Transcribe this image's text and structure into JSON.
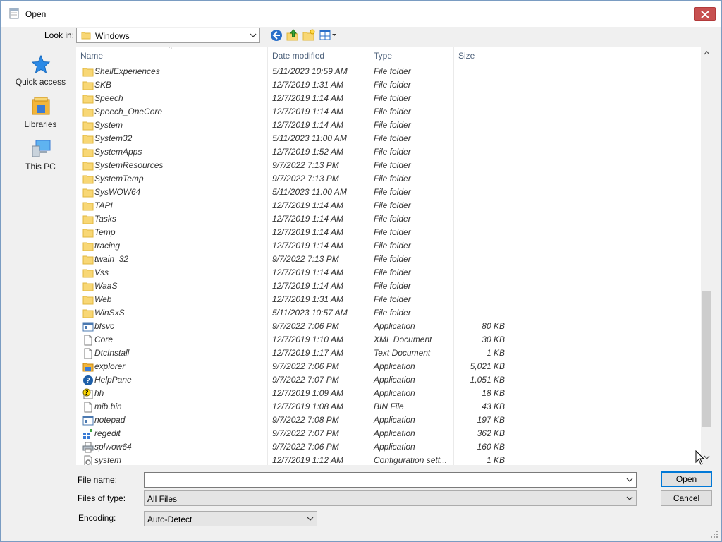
{
  "window": {
    "title": "Open"
  },
  "toolbar": {
    "look_in_label": "Look in:",
    "look_in_value": "Windows"
  },
  "places": [
    {
      "label": "Quick access",
      "icon": "star-icon"
    },
    {
      "label": "Libraries",
      "icon": "libraries-icon"
    },
    {
      "label": "This PC",
      "icon": "computer-icon"
    }
  ],
  "columns": {
    "name": "Name",
    "date": "Date modified",
    "type": "Type",
    "size": "Size"
  },
  "files": [
    {
      "name": "ShellExperiences",
      "date": "5/11/2023 10:59 AM",
      "type": "File folder",
      "size": "",
      "icon": "folder"
    },
    {
      "name": "SKB",
      "date": "12/7/2019 1:31 AM",
      "type": "File folder",
      "size": "",
      "icon": "folder"
    },
    {
      "name": "Speech",
      "date": "12/7/2019 1:14 AM",
      "type": "File folder",
      "size": "",
      "icon": "folder"
    },
    {
      "name": "Speech_OneCore",
      "date": "12/7/2019 1:14 AM",
      "type": "File folder",
      "size": "",
      "icon": "folder"
    },
    {
      "name": "System",
      "date": "12/7/2019 1:14 AM",
      "type": "File folder",
      "size": "",
      "icon": "folder"
    },
    {
      "name": "System32",
      "date": "5/11/2023 11:00 AM",
      "type": "File folder",
      "size": "",
      "icon": "folder"
    },
    {
      "name": "SystemApps",
      "date": "12/7/2019 1:52 AM",
      "type": "File folder",
      "size": "",
      "icon": "folder"
    },
    {
      "name": "SystemResources",
      "date": "9/7/2022 7:13 PM",
      "type": "File folder",
      "size": "",
      "icon": "folder"
    },
    {
      "name": "SystemTemp",
      "date": "9/7/2022 7:13 PM",
      "type": "File folder",
      "size": "",
      "icon": "folder"
    },
    {
      "name": "SysWOW64",
      "date": "5/11/2023 11:00 AM",
      "type": "File folder",
      "size": "",
      "icon": "folder"
    },
    {
      "name": "TAPI",
      "date": "12/7/2019 1:14 AM",
      "type": "File folder",
      "size": "",
      "icon": "folder"
    },
    {
      "name": "Tasks",
      "date": "12/7/2019 1:14 AM",
      "type": "File folder",
      "size": "",
      "icon": "folder"
    },
    {
      "name": "Temp",
      "date": "12/7/2019 1:14 AM",
      "type": "File folder",
      "size": "",
      "icon": "folder"
    },
    {
      "name": "tracing",
      "date": "12/7/2019 1:14 AM",
      "type": "File folder",
      "size": "",
      "icon": "folder"
    },
    {
      "name": "twain_32",
      "date": "9/7/2022 7:13 PM",
      "type": "File folder",
      "size": "",
      "icon": "folder"
    },
    {
      "name": "Vss",
      "date": "12/7/2019 1:14 AM",
      "type": "File folder",
      "size": "",
      "icon": "folder"
    },
    {
      "name": "WaaS",
      "date": "12/7/2019 1:14 AM",
      "type": "File folder",
      "size": "",
      "icon": "folder"
    },
    {
      "name": "Web",
      "date": "12/7/2019 1:31 AM",
      "type": "File folder",
      "size": "",
      "icon": "folder"
    },
    {
      "name": "WinSxS",
      "date": "5/11/2023 10:57 AM",
      "type": "File folder",
      "size": "",
      "icon": "folder"
    },
    {
      "name": "bfsvc",
      "date": "9/7/2022 7:06 PM",
      "type": "Application",
      "size": "80 KB",
      "icon": "app"
    },
    {
      "name": "Core",
      "date": "12/7/2019 1:10 AM",
      "type": "XML Document",
      "size": "30 KB",
      "icon": "doc"
    },
    {
      "name": "DtcInstall",
      "date": "12/7/2019 1:17 AM",
      "type": "Text Document",
      "size": "1 KB",
      "icon": "doc"
    },
    {
      "name": "explorer",
      "date": "9/7/2022 7:06 PM",
      "type": "Application",
      "size": "5,021 KB",
      "icon": "explorer"
    },
    {
      "name": "HelpPane",
      "date": "9/7/2022 7:07 PM",
      "type": "Application",
      "size": "1,051 KB",
      "icon": "help"
    },
    {
      "name": "hh",
      "date": "12/7/2019 1:09 AM",
      "type": "Application",
      "size": "18 KB",
      "icon": "hh"
    },
    {
      "name": "mib.bin",
      "date": "12/7/2019 1:08 AM",
      "type": "BIN File",
      "size": "43 KB",
      "icon": "doc"
    },
    {
      "name": "notepad",
      "date": "9/7/2022 7:08 PM",
      "type": "Application",
      "size": "197 KB",
      "icon": "app"
    },
    {
      "name": "regedit",
      "date": "9/7/2022 7:07 PM",
      "type": "Application",
      "size": "362 KB",
      "icon": "regedit"
    },
    {
      "name": "splwow64",
      "date": "9/7/2022 7:06 PM",
      "type": "Application",
      "size": "160 KB",
      "icon": "printer"
    },
    {
      "name": "system",
      "date": "12/7/2019 1:12 AM",
      "type": "Configuration sett...",
      "size": "1 KB",
      "icon": "config"
    }
  ],
  "bottom": {
    "file_name_label": "File name:",
    "file_name_value": "",
    "files_of_type_label": "Files of type:",
    "files_of_type_value": "All Files",
    "encoding_label": "Encoding:",
    "encoding_value": "Auto-Detect",
    "open_label": "Open",
    "cancel_label": "Cancel"
  },
  "colors": {
    "folder": "#f8d775",
    "folder_dark": "#e1b73f",
    "accent": "#0078d7",
    "close": "#c75050",
    "header_text": "#4c607a"
  }
}
